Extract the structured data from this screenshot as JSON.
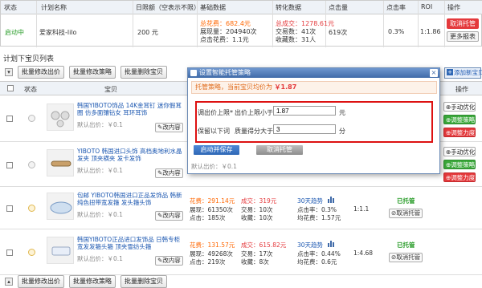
{
  "plan": {
    "headers": [
      "状态",
      "计划名称",
      "日限额（空表示不限）",
      "基础数据",
      "转化数据",
      "点击量",
      "点击率",
      "ROI",
      "操作"
    ],
    "status": "启动中",
    "name": "爱家科技-lilo",
    "daily_limit": "200 元",
    "spend_label": "总花费：",
    "spend": "682.4元",
    "impressions": "展现量：204940次",
    "cpc": "点击花费：1.1元",
    "total_amount_label": "总成交：",
    "total_amount": "1278.61元",
    "orders": "交易数：41次",
    "favorites": "收藏数：31人",
    "clicks": "619次",
    "ctr": "0.3%",
    "roi": "1:1.86",
    "cancel_label": "取消托管",
    "report_label": "更多报表"
  },
  "section_title": "计划下宝贝列表",
  "toolbar": {
    "modify_price": "批量修改出价",
    "modify_strategy": "批量修改策略",
    "delete_item": "批量删除宝贝",
    "add_item": "添加新宝贝"
  },
  "grid": {
    "status_header": "状态",
    "item_header": "宝贝",
    "action_header": "操作"
  },
  "items": [
    {
      "title": "韩国YIBOTO饰品 14K金耳钉 迷你假耳圈 仿多面镶钻女 耳环耳饰",
      "price": "默认出价：￥0.1",
      "edit": "改内容",
      "actions": [
        "手动优化",
        "调整策略",
        "调整力度"
      ]
    },
    {
      "title": "YIBOTO 韩国进口头饰 高档奥地利水晶发夹 顶夹横夹 发卡发饰",
      "price": "默认出价：￥0.1",
      "edit": "改内容",
      "actions": [
        "手动优化",
        "调整策略",
        "调整力度"
      ]
    },
    {
      "title": "包邮 YIBOTO韩国进口正品发饰品 韩新纯色扭带宽发箍 发头箍头饰",
      "price": "默认出价：￥0.1",
      "edit": "改内容",
      "spend": "花费：291.14元",
      "impressions": "展现：61350次",
      "clicks": "点击：185次",
      "deal": "成交：319元",
      "orders": "交易：10次",
      "favs": "收藏：10次",
      "trend": "30天趋势",
      "ctr": "点击率：0.3%",
      "avg": "均花费：1.57元",
      "roi": "1:1.1",
      "managed": "已托管",
      "cancel": "取消托管"
    },
    {
      "title": "韩国YIBOTO正品进口发饰品 日韩专柜宽发发箍头箍 顶夹雪纺头箍",
      "price": "默认出价：￥0.1",
      "edit": "改内容",
      "spend": "花费：131.57元",
      "impressions": "展现：49268次",
      "clicks": "点击：219次",
      "deal": "成交：615.82元",
      "orders": "交易：17次",
      "favs": "收藏：8次",
      "trend": "30天趋势",
      "ctr": "点击率：0.44%",
      "avg": "均花费：0.6元",
      "roi": "1:4.68",
      "managed": "已托管",
      "cancel": "取消托管"
    }
  ],
  "modal": {
    "title": "设置智能托管策略",
    "close": "×",
    "header_label": "托管策略，当前宝贝均价为",
    "header_price": "￥1.87",
    "row1_label": "调出价上限*",
    "row1_field": "出价上限小于",
    "row1_value": "1.87",
    "row1_unit": "元",
    "row2_label": "保留以下词",
    "row2_field": "质量得分大于",
    "row2_value": "3",
    "row2_unit": "分",
    "save": "启动并保存",
    "cancel": "取消托管",
    "hidden_price": "默认出价：￥0.1"
  },
  "colors": {
    "accent_red": "#e4393c",
    "brand_blue": "#1a56b0",
    "managed_green": "#2a9d2a"
  }
}
